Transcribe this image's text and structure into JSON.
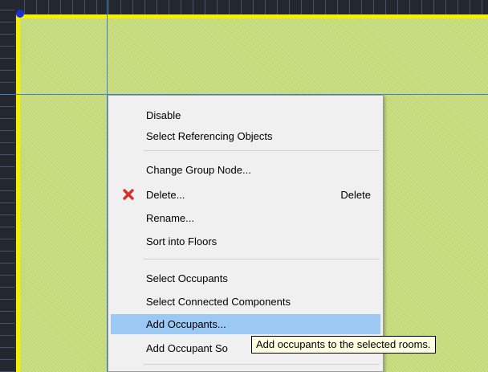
{
  "colors": {
    "room_fill": "#c3d978",
    "room_border": "#f5f000",
    "guide_line": "#3f7fd0",
    "menu_highlight": "#9cc8f4",
    "delete_icon": "#d93025"
  },
  "context_menu": {
    "items": [
      {
        "label": "Disable"
      },
      {
        "label": "Select Referencing Objects"
      },
      {
        "label": "Change Group Node..."
      },
      {
        "label": "Delete...",
        "shortcut": "Delete",
        "icon": "delete-x-icon"
      },
      {
        "label": "Rename..."
      },
      {
        "label": "Sort into Floors"
      },
      {
        "label": "Select Occupants"
      },
      {
        "label": "Select Connected Components"
      },
      {
        "label": "Add Occupants..."
      },
      {
        "label": "Add Occupant So"
      }
    ],
    "highlighted_item": "Add Occupants..."
  },
  "tooltip": {
    "text": "Add occupants to the selected rooms."
  }
}
